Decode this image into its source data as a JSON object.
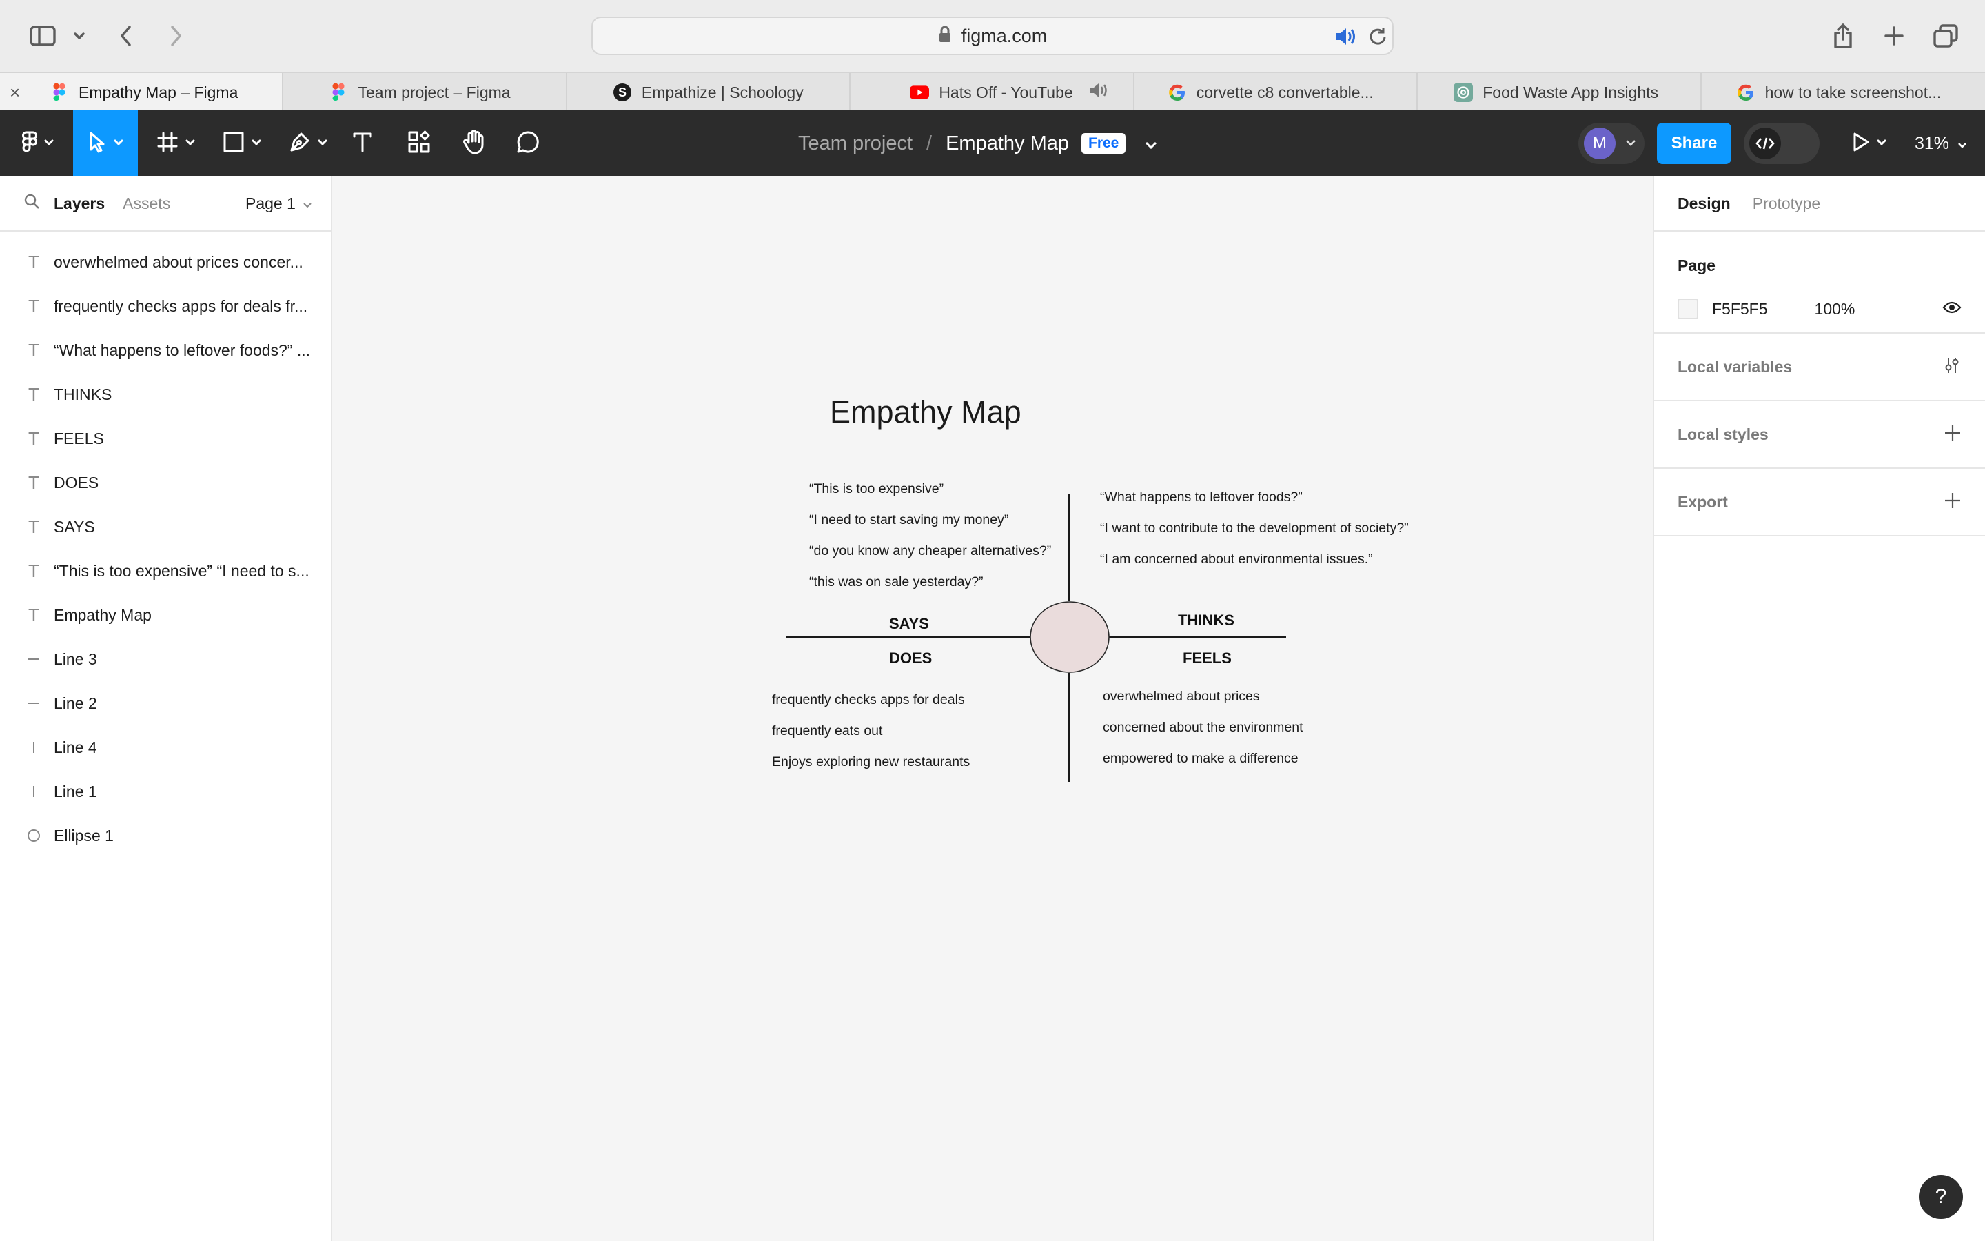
{
  "browser": {
    "url": "figma.com",
    "tabs": [
      {
        "label": "Empathy Map – Figma",
        "icon": "figma-icon",
        "active": true
      },
      {
        "label": "Team project – Figma",
        "icon": "figma-icon"
      },
      {
        "label": "Empathize | Schoology",
        "icon": "schoology-icon"
      },
      {
        "label": "Hats Off - YouTube",
        "icon": "youtube-icon",
        "muted_icon": "speaker-muted-icon"
      },
      {
        "label": "corvette c8 convertable...",
        "icon": "google-icon"
      },
      {
        "label": "Food Waste App Insights",
        "icon": "chatgpt-icon"
      },
      {
        "label": "how to take screenshot...",
        "icon": "google-icon"
      }
    ]
  },
  "toolbar": {
    "project": "Team project",
    "separator": "/",
    "file": "Empathy Map",
    "plan_badge": "Free",
    "avatar_initial": "M",
    "share_label": "Share",
    "zoom": "31%"
  },
  "left_panel": {
    "tabs": [
      "Layers",
      "Assets"
    ],
    "page": "Page 1",
    "layers": [
      {
        "type": "text",
        "name": "overwhelmed about prices concer..."
      },
      {
        "type": "text",
        "name": "frequently checks apps for deals fr..."
      },
      {
        "type": "text",
        "name": "“What happens to leftover foods?” ..."
      },
      {
        "type": "text",
        "name": "THINKS"
      },
      {
        "type": "text",
        "name": "FEELS"
      },
      {
        "type": "text",
        "name": "DOES"
      },
      {
        "type": "text",
        "name": "SAYS"
      },
      {
        "type": "text",
        "name": "“This is too expensive” “I need to s..."
      },
      {
        "type": "text",
        "name": "Empathy Map"
      },
      {
        "type": "hline",
        "name": "Line 3"
      },
      {
        "type": "hline",
        "name": "Line 2"
      },
      {
        "type": "vline",
        "name": "Line 4"
      },
      {
        "type": "vline",
        "name": "Line 1"
      },
      {
        "type": "ellipse",
        "name": "Ellipse 1"
      }
    ]
  },
  "right_panel": {
    "tabs": [
      "Design",
      "Prototype"
    ],
    "page_title": "Page",
    "page_color": "F5F5F5",
    "page_opacity": "100%",
    "local_variables": "Local variables",
    "local_styles": "Local styles",
    "export": "Export"
  },
  "canvas": {
    "title": "Empathy Map",
    "says_label": "SAYS",
    "thinks_label": "THINKS",
    "does_label": "DOES",
    "feels_label": "FEELS",
    "says": [
      "“This is too expensive”",
      "“I need to start saving my money”",
      "“do you know any cheaper alternatives?”",
      "“this was on sale yesterday?”"
    ],
    "thinks": [
      "“What happens to leftover foods?”",
      "“I want to contribute to the development of society?”",
      "“I am concerned about environmental issues.”"
    ],
    "does": [
      "frequently checks apps for deals",
      "frequently eats out",
      "Enjoys exploring new restaurants"
    ],
    "feels": [
      "overwhelmed about prices",
      "concerned about the environment",
      "empowered to make a difference"
    ],
    "ellipse_color": "#eadcdc"
  },
  "colors": {
    "accent": "#0d99ff",
    "toolbar_bg": "#2c2c2c",
    "canvas_bg": "#f5f5f5"
  },
  "help_label": "?"
}
